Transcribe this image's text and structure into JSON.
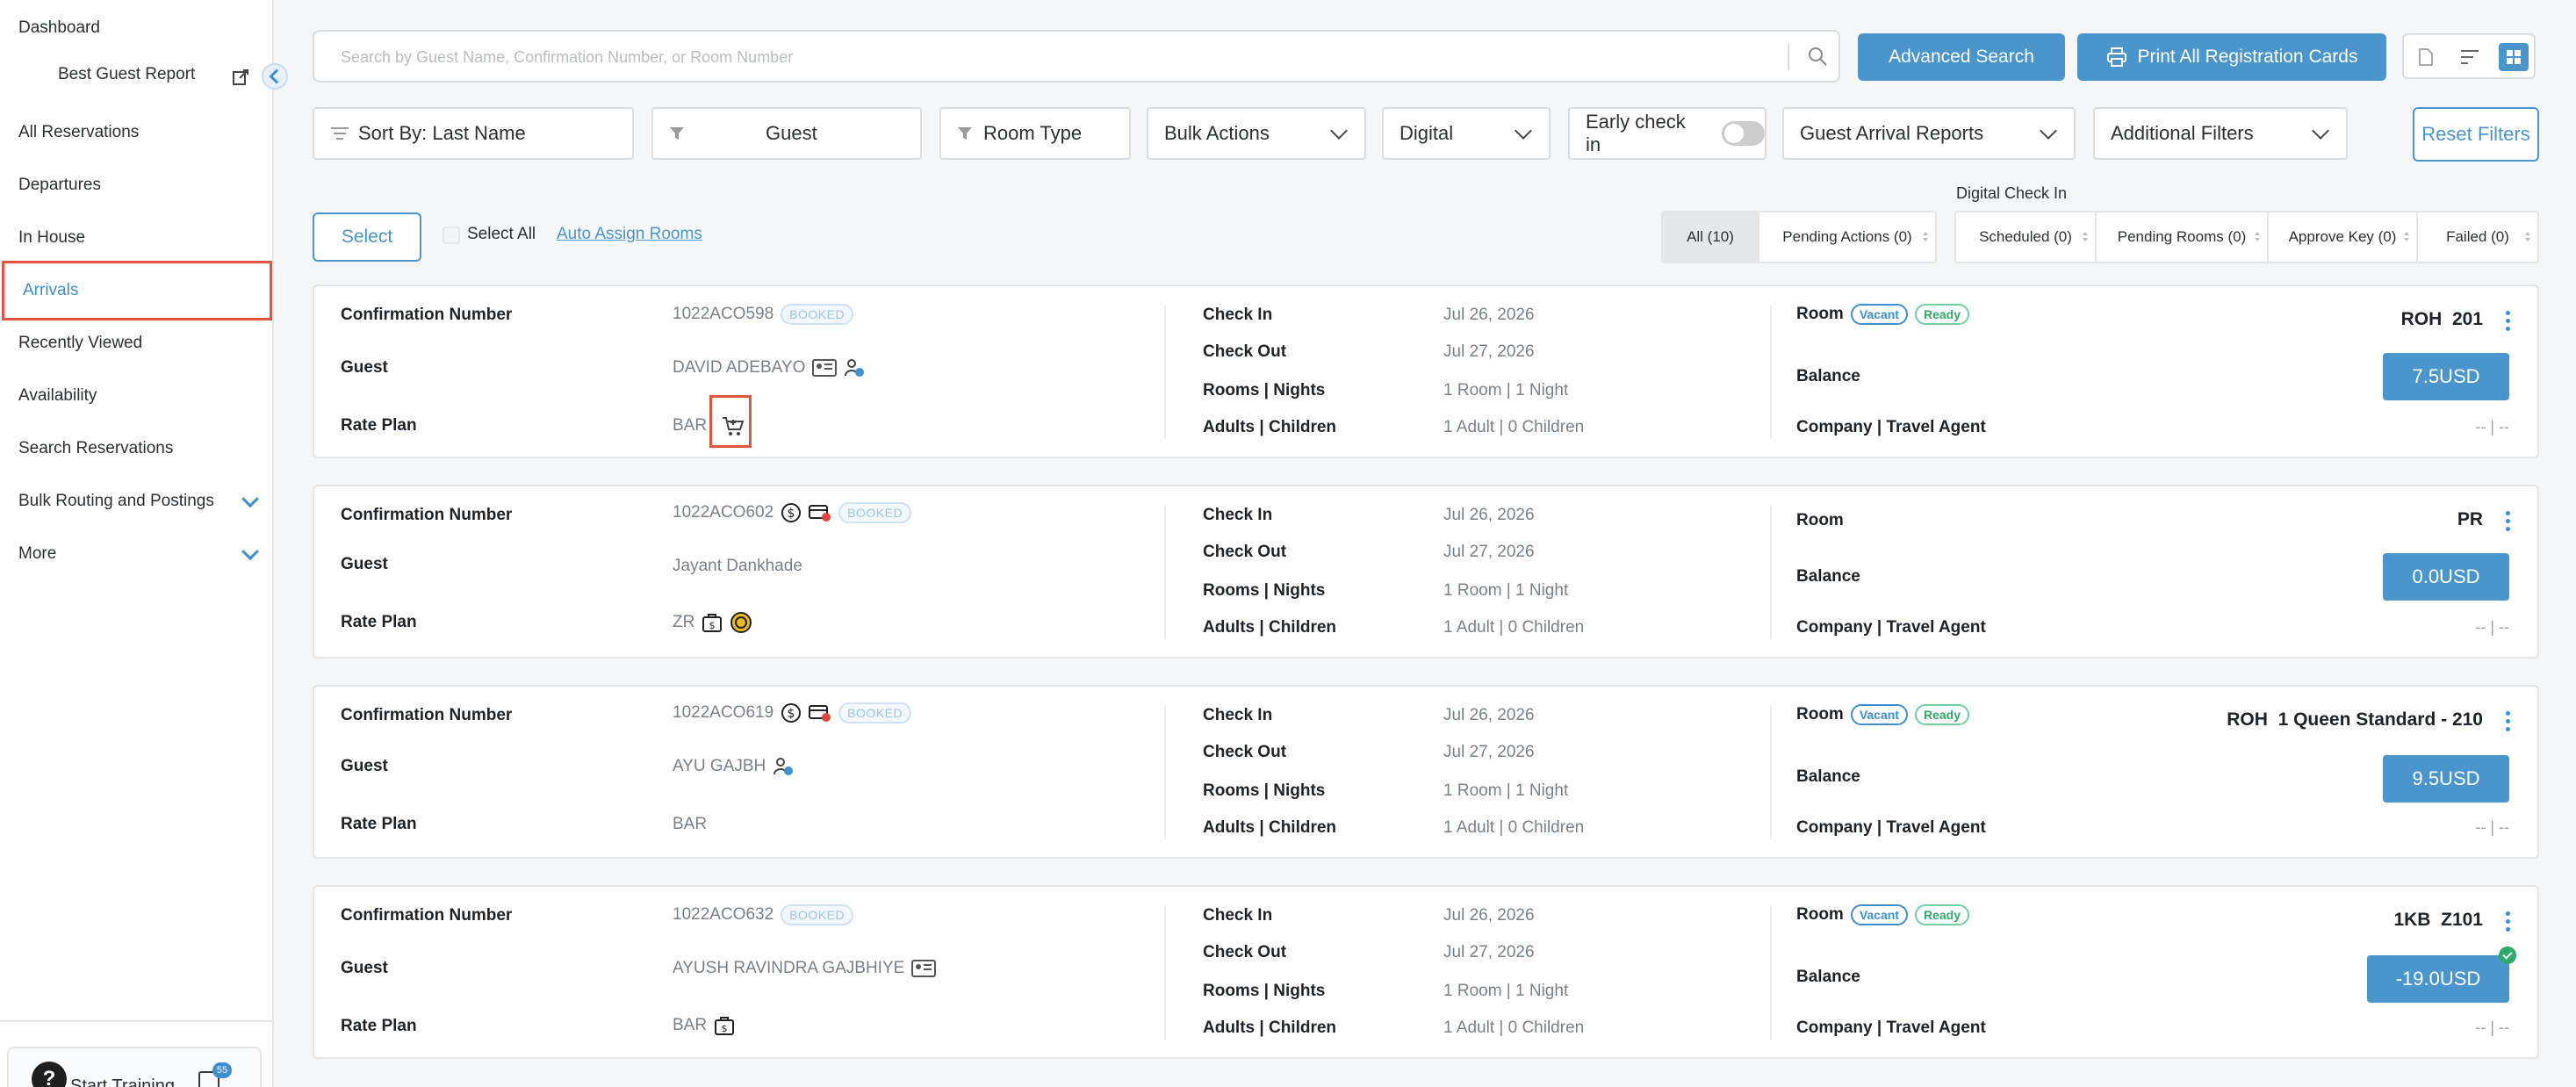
{
  "sidebar": {
    "items": [
      {
        "label": "Dashboard"
      },
      {
        "label": "All Reservations"
      },
      {
        "label": "Departures"
      },
      {
        "label": "In House"
      },
      {
        "label": "Arrivals"
      },
      {
        "label": "Recently Viewed"
      },
      {
        "label": "Availability"
      },
      {
        "label": "Search Reservations"
      },
      {
        "label": "Bulk Routing and Postings"
      },
      {
        "label": "More"
      }
    ],
    "sub_item": "Best Guest Report",
    "training_label": "Start Training",
    "message_badge": "55"
  },
  "toolbar": {
    "search_placeholder": "Search by Guest Name, Confirmation Number, or Room Number",
    "advanced_search": "Advanced Search",
    "print_all": "Print All Registration Cards"
  },
  "filters": {
    "sort_by": "Sort By: Last Name",
    "guest": "Guest",
    "room_type": "Room Type",
    "bulk_actions": "Bulk Actions",
    "digital": "Digital",
    "early_check_in": "Early check in",
    "guest_arrival_reports": "Guest Arrival Reports",
    "additional_filters": "Additional Filters",
    "reset": "Reset Filters"
  },
  "selection": {
    "select": "Select",
    "select_all": "Select All",
    "auto_assign": "Auto Assign Rooms",
    "digital_check_in_label": "Digital Check In",
    "tabs": [
      "All (10)",
      "Pending Actions (0)",
      "Scheduled (0)",
      "Pending Rooms (0)",
      "Approve Key (0)",
      "Failed (0)"
    ]
  },
  "labels": {
    "confirmation": "Confirmation Number",
    "guest": "Guest",
    "rate_plan": "Rate Plan",
    "check_in": "Check In",
    "check_out": "Check Out",
    "rooms_nights": "Rooms | Nights",
    "adults_children": "Adults | Children",
    "room": "Room",
    "balance": "Balance",
    "company": "Company | Travel Agent",
    "booked": "BOOKED",
    "vacant": "Vacant",
    "ready": "Ready"
  },
  "reservations": [
    {
      "confirmation": "1022ACO598",
      "guest": "DAVID ADEBAYO",
      "rate_plan": "BAR",
      "check_in": "Jul 26, 2026",
      "check_out": "Jul 27, 2026",
      "rooms_nights": "1 Room | 1 Night",
      "adults_children": "1 Adult | 0 Children",
      "room_type": "ROH",
      "room_number": "201",
      "balance": "7.5USD",
      "company": "-- | --"
    },
    {
      "confirmation": "1022ACO602",
      "guest": "Jayant Dankhade",
      "rate_plan": "ZR",
      "check_in": "Jul 26, 2026",
      "check_out": "Jul 27, 2026",
      "rooms_nights": "1 Room | 1 Night",
      "adults_children": "1 Adult | 0 Children",
      "room_type": "PR",
      "room_number": "",
      "balance": "0.0USD",
      "company": "-- | --"
    },
    {
      "confirmation": "1022ACO619",
      "guest": "AYU GAJBH",
      "rate_plan": "BAR",
      "check_in": "Jul 26, 2026",
      "check_out": "Jul 27, 2026",
      "rooms_nights": "1 Room | 1 Night",
      "adults_children": "1 Adult | 0 Children",
      "room_type": "ROH",
      "room_number": "1 Queen Standard - 210",
      "balance": "9.5USD",
      "company": "-- | --"
    },
    {
      "confirmation": "1022ACO632",
      "guest": "AYUSH RAVINDRA GAJBHIYE",
      "rate_plan": "BAR",
      "check_in": "Jul 26, 2026",
      "check_out": "Jul 27, 2026",
      "rooms_nights": "1 Room | 1 Night",
      "adults_children": "1 Adult | 0 Children",
      "room_type": "1KB",
      "room_number": "Z101",
      "balance": "-19.0USD",
      "company": "-- | --"
    }
  ],
  "colors": {
    "accent": "#4a95cc",
    "highlight": "#e0553f",
    "ready": "#2eaa6b"
  }
}
